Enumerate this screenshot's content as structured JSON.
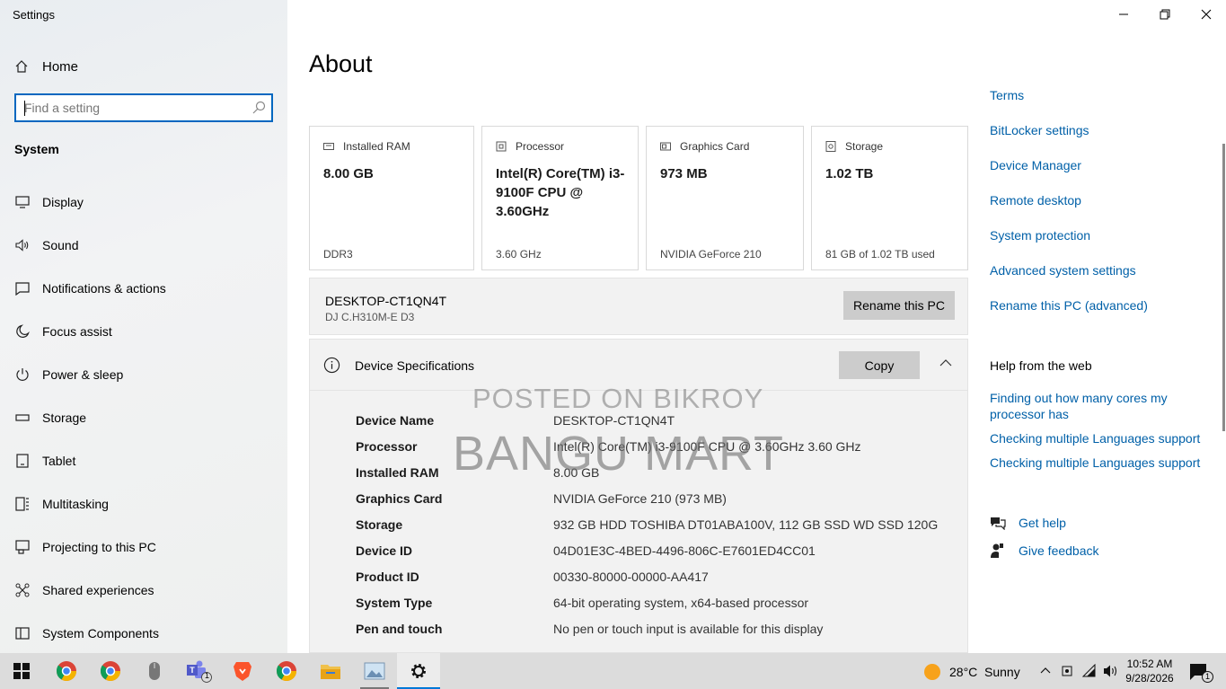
{
  "window": {
    "title": "Settings"
  },
  "sidebar": {
    "home_label": "Home",
    "search_placeholder": "Find a setting",
    "section_label": "System",
    "items": [
      {
        "label": "Display",
        "icon": "monitor-icon"
      },
      {
        "label": "Sound",
        "icon": "speaker-icon"
      },
      {
        "label": "Notifications & actions",
        "icon": "notification-icon"
      },
      {
        "label": "Focus assist",
        "icon": "moon-icon"
      },
      {
        "label": "Power & sleep",
        "icon": "power-icon"
      },
      {
        "label": "Storage",
        "icon": "storage-icon"
      },
      {
        "label": "Tablet",
        "icon": "tablet-icon"
      },
      {
        "label": "Multitasking",
        "icon": "multitasking-icon"
      },
      {
        "label": "Projecting to this PC",
        "icon": "projecting-icon"
      },
      {
        "label": "Shared experiences",
        "icon": "shared-experiences-icon"
      },
      {
        "label": "System Components",
        "icon": "system-components-icon"
      }
    ]
  },
  "main": {
    "title": "About",
    "cards": [
      {
        "label": "Installed RAM",
        "value": "8.00 GB",
        "sub": "DDR3",
        "icon": "ram-icon"
      },
      {
        "label": "Processor",
        "value": "Intel(R) Core(TM) i3-9100F CPU @ 3.60GHz",
        "sub": "3.60 GHz",
        "icon": "processor-icon"
      },
      {
        "label": "Graphics Card",
        "value": "973 MB",
        "sub": "NVIDIA GeForce 210",
        "icon": "graphics-card-icon"
      },
      {
        "label": "Storage",
        "value": "1.02 TB",
        "sub": "81 GB of 1.02 TB used",
        "icon": "storage-icon"
      }
    ],
    "pc": {
      "name": "DESKTOP-CT1QN4T",
      "model": "DJ C.H310M-E D3",
      "rename_label": "Rename this PC"
    },
    "specs": {
      "title": "Device Specifications",
      "copy_label": "Copy",
      "rows": [
        {
          "key": "Device Name",
          "value": "DESKTOP-CT1QN4T"
        },
        {
          "key": "Processor",
          "value": "Intel(R) Core(TM) i3-9100F CPU @ 3.60GHz   3.60 GHz"
        },
        {
          "key": "Installed RAM",
          "value": "8.00 GB"
        },
        {
          "key": "Graphics Card",
          "value": "NVIDIA GeForce 210  (973 MB)"
        },
        {
          "key": "Storage",
          "value": "932 GB HDD TOSHIBA DT01ABA100V, 112 GB SSD WD  SSD 120G"
        },
        {
          "key": "Device ID",
          "value": "04D01E3C-4BED-4496-806C-E7601ED4CC01"
        },
        {
          "key": "Product ID",
          "value": "00330-80000-00000-AA417"
        },
        {
          "key": "System Type",
          "value": "64-bit operating system, x64-based processor"
        },
        {
          "key": "Pen and touch",
          "value": "No pen or touch input is available for this display"
        }
      ]
    },
    "watermark": {
      "line1": "POSTED ON BIKROY",
      "line2": "BANGU MART"
    }
  },
  "related": {
    "links": [
      "Terms",
      "BitLocker settings",
      "Device Manager",
      "Remote desktop",
      "System protection",
      "Advanced system settings",
      "Rename this PC (advanced)"
    ],
    "help_heading": "Help from the web",
    "help_links": [
      "Finding out how many cores my processor has",
      "Checking multiple Languages support",
      "Checking multiple Languages support"
    ],
    "get_help": "Get help",
    "give_feedback": "Give feedback"
  },
  "taskbar": {
    "weather_temp": "28°C",
    "weather_desc": "Sunny",
    "time": "10:52 AM",
    "date": "9/28/2026",
    "teams_badge": "1",
    "notification_badge": "1"
  },
  "colors": {
    "accent": "#0067c0",
    "link": "#0060a8",
    "taskbar": "#dcdcdc"
  }
}
